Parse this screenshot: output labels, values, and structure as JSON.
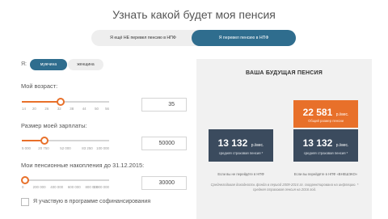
{
  "header": {
    "title": "Узнать какой будет моя пенсия"
  },
  "tabs": [
    {
      "label": "Я ещё НЕ перевел пенсию в НПФ",
      "active": false
    },
    {
      "label": "Я перевел пенсию в НПФ",
      "active": true
    }
  ],
  "gender": {
    "label": "Я:",
    "options": [
      "мужчина",
      "женщина"
    ],
    "selected": "мужчина"
  },
  "age": {
    "label": "Мой возраст:",
    "value": "35",
    "ticks": [
      "14",
      "20",
      "26",
      "32",
      "38",
      "44",
      "50",
      "56"
    ],
    "slider_fraction": 0.44
  },
  "salary": {
    "label": "Размер моей зарплаты:",
    "value": "50000",
    "ticks": [
      "5 000",
      "20 750",
      "52 000",
      "83 250",
      "100 000"
    ],
    "slider_fraction": 0.26
  },
  "savings": {
    "label": "Мои пенсионные накопления до 31.12.2015:",
    "value": "30000",
    "ticks": [
      "0",
      "200 000",
      "400 000",
      "600 000",
      "800 000",
      "1 000 000"
    ],
    "slider_fraction": 0.04
  },
  "cofinancing": {
    "label": "Я участвую в программе софинансирования",
    "checked": false
  },
  "result": {
    "title": "ВАША БУДУЩАЯ ПЕНСИЯ",
    "npf_total": {
      "amount": "22 581",
      "unit": "р./мес.",
      "caption": "Общий размер пенсии"
    },
    "left": {
      "amount": "13 132",
      "unit": "р./мес.",
      "caption": "средняя страховая пенсия *"
    },
    "right": {
      "amount": "13 132",
      "unit": "р./мес.",
      "caption": "средняя страховая пенсия *"
    },
    "left_note": "Если вы не перейдёте в НПФ",
    "right_note": "Если вы перейдёте в НПФ «ВНЕШЭКО»",
    "footnote": "Среднегодовая доходность фонда в период 2009-2014 гг. скорректирована на инфляцию. * средняя страховая пенсия на 2016 год."
  },
  "colors": {
    "accent": "#e8702a",
    "primary": "#2f6d8e",
    "dark_box": "#3b4b5e"
  }
}
